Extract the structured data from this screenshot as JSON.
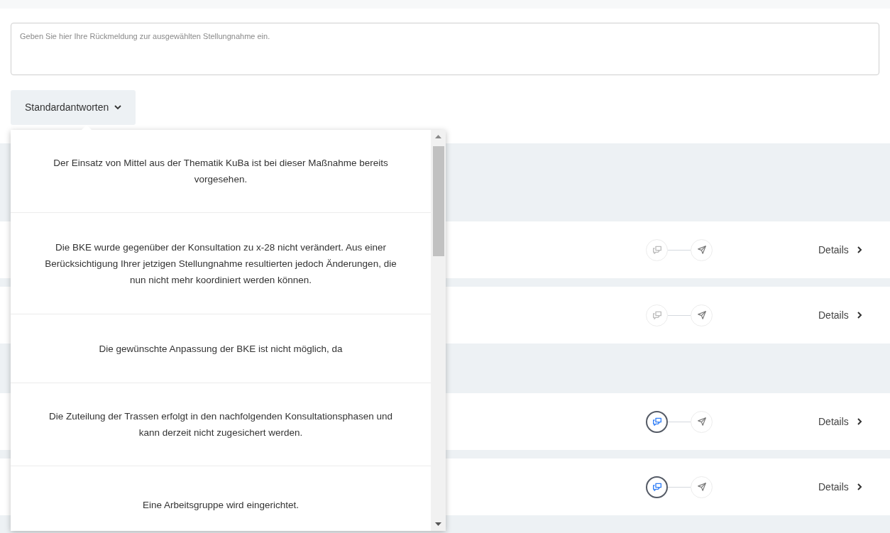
{
  "feedback_field": {
    "placeholder": "Geben Sie hier Ihre Rückmeldung zur ausgewählten Stellungnahme ein."
  },
  "standard_answers": {
    "label": "Standardantworten",
    "options": [
      {
        "text": "Der Einsatz von Mittel aus der Thematik KuBa ist bei dieser Maßnahme bereits vorgesehen."
      },
      {
        "text": "Die BKE wurde gegenüber der Konsultation zu x-28 nicht verändert. Aus einer Berücksichtigung Ihrer jetzigen Stellungnahme resultierten jedoch Änderungen, die nun nicht mehr koordiniert werden können."
      },
      {
        "text": "Die gewünschte Anpassung der BKE ist nicht möglich, da"
      },
      {
        "text": "Die Zuteilung der Trassen erfolgt in den nachfolgenden Konsultationsphasen und kann derzeit nicht zugesichert werden."
      },
      {
        "text": "Eine Arbeitsgruppe wird eingerichtet."
      }
    ]
  },
  "list": [
    {
      "kind": "group"
    },
    {
      "kind": "row",
      "feedback": false,
      "link": "Details"
    },
    {
      "kind": "row",
      "feedback": false,
      "link": "Details"
    },
    {
      "kind": "group"
    },
    {
      "kind": "row",
      "feedback": true,
      "link": "Details"
    },
    {
      "kind": "row",
      "feedback": true,
      "link": "Details"
    },
    {
      "kind": "group"
    }
  ]
}
